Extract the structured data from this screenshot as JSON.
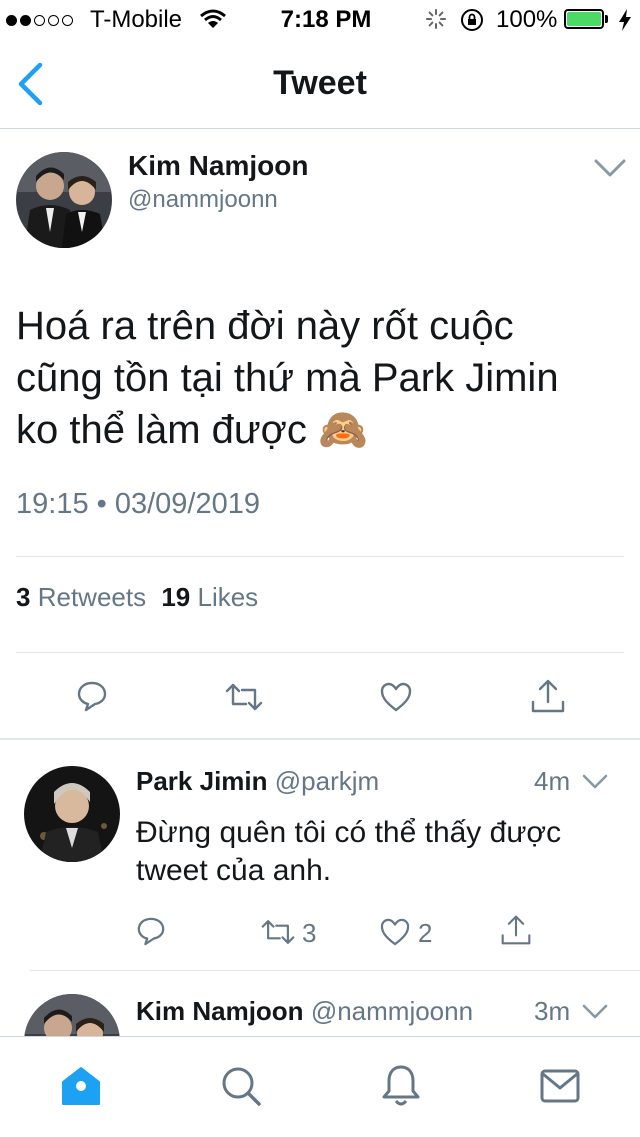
{
  "status_bar": {
    "carrier": "T-Mobile",
    "time": "7:18 PM",
    "battery": "100%",
    "signal_bars_filled": 2,
    "signal_bars_total": 5
  },
  "nav": {
    "title": "Tweet",
    "back_icon": "chevron-left-icon"
  },
  "tweet": {
    "author_name": "Kim Namjoon",
    "author_handle": "@nammjoonn",
    "text_line1": "Hoá ra trên đời này rốt cuộc",
    "text_line2": "cũng tồn tại thứ mà Park Jimin",
    "text_line3": "ko thể làm được 🙈",
    "timestamp": "19:15 • 03/09/2019",
    "retweets_count": "3",
    "retweets_label": "Retweets",
    "likes_count": "19",
    "likes_label": "Likes"
  },
  "replies": [
    {
      "author_name": "Park Jimin",
      "author_handle": "@parkjm",
      "time": "4m",
      "text_line1": "Đừng quên tôi có thể thấy được",
      "text_line2": "tweet của anh.",
      "retweets": "3",
      "likes": "2"
    },
    {
      "author_name": "Kim Namjoon",
      "author_handle": "@nammjoonn",
      "time": "3m"
    }
  ],
  "tab_bar": {
    "items": [
      "home-icon",
      "search-icon",
      "notifications-icon",
      "messages-icon"
    ],
    "active": "home-icon"
  },
  "colors": {
    "accent": "#1da1f2",
    "secondary_text": "#657786",
    "battery": "#4cd964"
  }
}
